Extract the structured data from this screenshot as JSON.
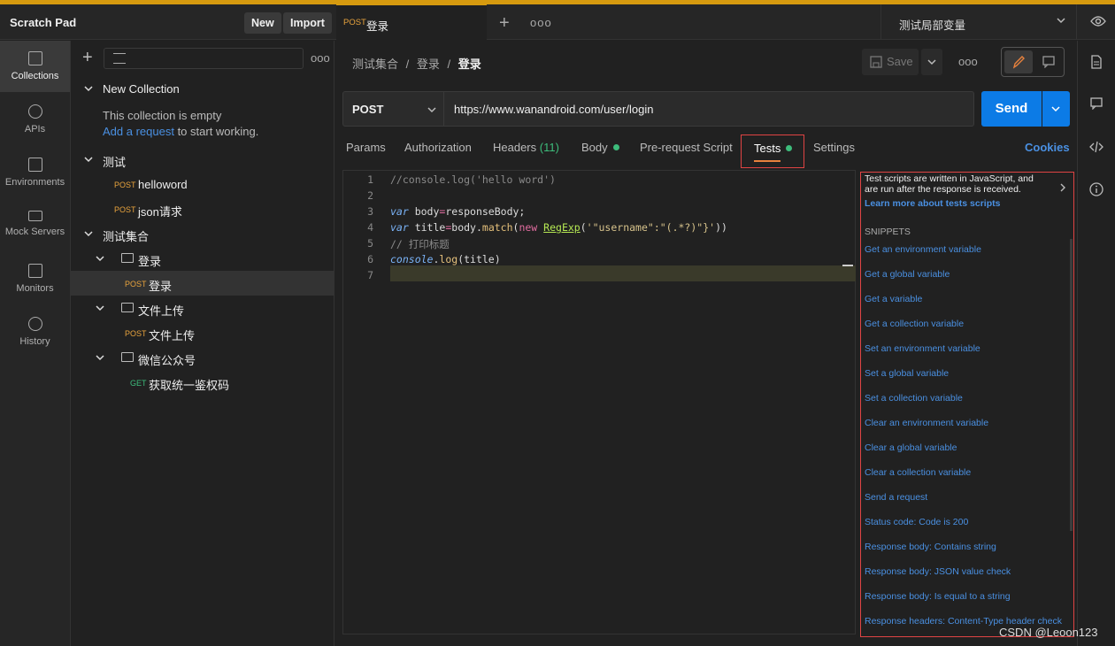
{
  "header": {
    "workspace_title": "Scratch Pad",
    "new_label": "New",
    "import_label": "Import",
    "request_tab": {
      "method": "POST",
      "name": "登录"
    },
    "tab_more": "ooo",
    "environment": "测试局部变量"
  },
  "rail": {
    "items": [
      {
        "label": "Collections",
        "icon": "collections-icon"
      },
      {
        "label": "APIs",
        "icon": "apis-icon"
      },
      {
        "label": "Environments",
        "icon": "environments-icon"
      },
      {
        "label": "Mock Servers",
        "icon": "mock-servers-icon"
      },
      {
        "label": "Monitors",
        "icon": "monitors-icon"
      },
      {
        "label": "History",
        "icon": "history-icon"
      }
    ]
  },
  "sidebar": {
    "more": "ooo",
    "collection_new": "New Collection",
    "empty_text": "This collection is empty",
    "empty_link": "Add a request",
    "empty_suffix": " to start working.",
    "test_collection": "测试",
    "test_requests": [
      {
        "method": "POST",
        "name": "helloword"
      },
      {
        "method": "POST",
        "name": "json请求"
      }
    ],
    "set_collection": "测试集合",
    "folders": [
      {
        "name": "登录",
        "request": {
          "method": "POST",
          "name": "登录"
        }
      },
      {
        "name": "文件上传",
        "request": {
          "method": "POST",
          "name": "文件上传"
        }
      },
      {
        "name": "微信公众号",
        "request": {
          "method": "GET",
          "name": "获取统一鉴权码"
        }
      }
    ]
  },
  "breadcrumb": {
    "part1": "测试集合",
    "sep": "/",
    "part2": "登录",
    "current": "登录"
  },
  "toolbar": {
    "save_label": "Save",
    "more": "ooo"
  },
  "request": {
    "method": "POST",
    "url": "https://www.wanandroid.com/user/login",
    "send_label": "Send"
  },
  "req_tabs": {
    "params": "Params",
    "authorization": "Authorization",
    "headers": "Headers",
    "headers_count": "(11)",
    "body": "Body",
    "prerequest": "Pre-request Script",
    "tests": "Tests",
    "settings": "Settings",
    "cookies": "Cookies"
  },
  "editor": {
    "line_numbers": [
      "1",
      "2",
      "3",
      "4",
      "5",
      "6",
      "7"
    ],
    "line1": "//console.log('hello word')",
    "line3_kw": "var",
    "line3_a": " body",
    "line3_op": "=",
    "line3_b": "responseBody;",
    "line4_kw": "var",
    "line4_a": " title",
    "line4_op": "=",
    "line4_b": "body.",
    "line4_fn": "match",
    "line4_c": "(",
    "line4_new": "new",
    "line4_sp": " ",
    "line4_cls": "RegExp",
    "line4_d": "(",
    "line4_str": "'\"username\":\"(.*?)\"}'",
    "line4_e": "))",
    "line5": "// 打印标题",
    "line6_obj": "console",
    "line6_b": ".",
    "line6_fn": "log",
    "line6_c": "(title)"
  },
  "snippets": {
    "desc": "Test scripts are written in JavaScript, and are run after the response is received.",
    "learn": "Learn more about tests scripts",
    "heading": "SNIPPETS",
    "items": [
      "Get an environment variable",
      "Get a global variable",
      "Get a variable",
      "Get a collection variable",
      "Set an environment variable",
      "Set a global variable",
      "Set a collection variable",
      "Clear an environment variable",
      "Clear a global variable",
      "Clear a collection variable",
      "Send a request",
      "Status code: Code is 200",
      "Response body: Contains string",
      "Response body: JSON value check",
      "Response body: Is equal to a string",
      "Response headers: Content-Type header check"
    ]
  },
  "watermark": "CSDN @Leoon123",
  "colors": {
    "accent": "#0c7be6",
    "post": "#e8a33d",
    "get": "#3dbc7b",
    "highlight": "#e04444"
  }
}
